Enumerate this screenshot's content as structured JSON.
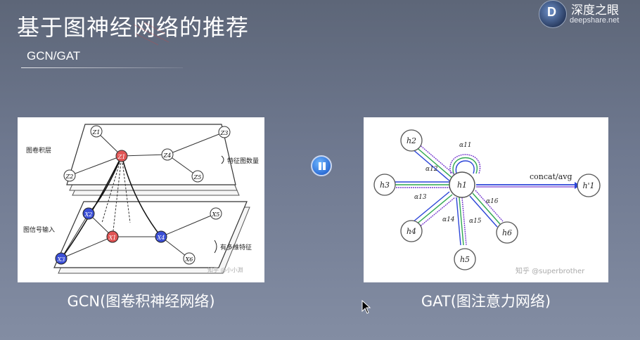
{
  "slide": {
    "title": "基于图神经网络的推荐",
    "subtitle": "GCN/GAT"
  },
  "logo": {
    "letter": "D",
    "name_cn": "深度之眼",
    "name_en": "deepshare.net"
  },
  "gcn": {
    "caption": "GCN(图卷积神经网络)",
    "labels": {
      "conv_layer": "图卷积层",
      "feature_maps": "特征图数量",
      "signal_input": "图信号输入",
      "multi_features": "有多维特征",
      "watermark": "知乎 @小小淵"
    },
    "top_nodes": [
      "Z1",
      "Z2",
      "Z3",
      "Z4",
      "Z5",
      "Z1"
    ],
    "bottom_nodes": [
      "X1",
      "X2",
      "X3",
      "X4",
      "X5",
      "X6"
    ]
  },
  "gat": {
    "caption": "GAT(图注意力网络)",
    "labels": {
      "concat": "concat/avg",
      "watermark": "知乎 @superbrother"
    },
    "center": "h1",
    "output": "h'1",
    "neighbors": [
      "h2",
      "h3",
      "h4",
      "h5",
      "h6"
    ],
    "alphas": [
      "α11",
      "α12",
      "α13",
      "α14",
      "α15",
      "α16"
    ]
  },
  "controls": {
    "pause_icon": "pause-icon"
  },
  "colors": {
    "red_node": "#e05555",
    "blue_node": "#3b4fd6",
    "green_edge": "#2fa84f",
    "purple_edge": "#7a3fd0",
    "blue_edge": "#2c45d8"
  }
}
